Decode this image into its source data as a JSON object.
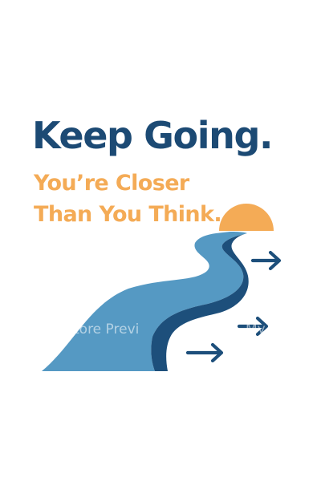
{
  "poster": {
    "headline": "Keep Going.",
    "subline_1": "You’re Closer",
    "subline_2": "Than You Think."
  },
  "watermark": {
    "left_text": "tore Previ",
    "right_text": "My"
  },
  "colors": {
    "headline": "#1c4a74",
    "accent_orange": "#f4ab56",
    "river_light": "#5599c3",
    "river_dark": "#1d4f7b",
    "arrow": "#1d4f7b",
    "background": "#ffffff"
  },
  "icons": [
    "sun-icon",
    "river-path-icon",
    "arrow-right-icon",
    "arrow-right-icon",
    "arrow-right-icon"
  ]
}
